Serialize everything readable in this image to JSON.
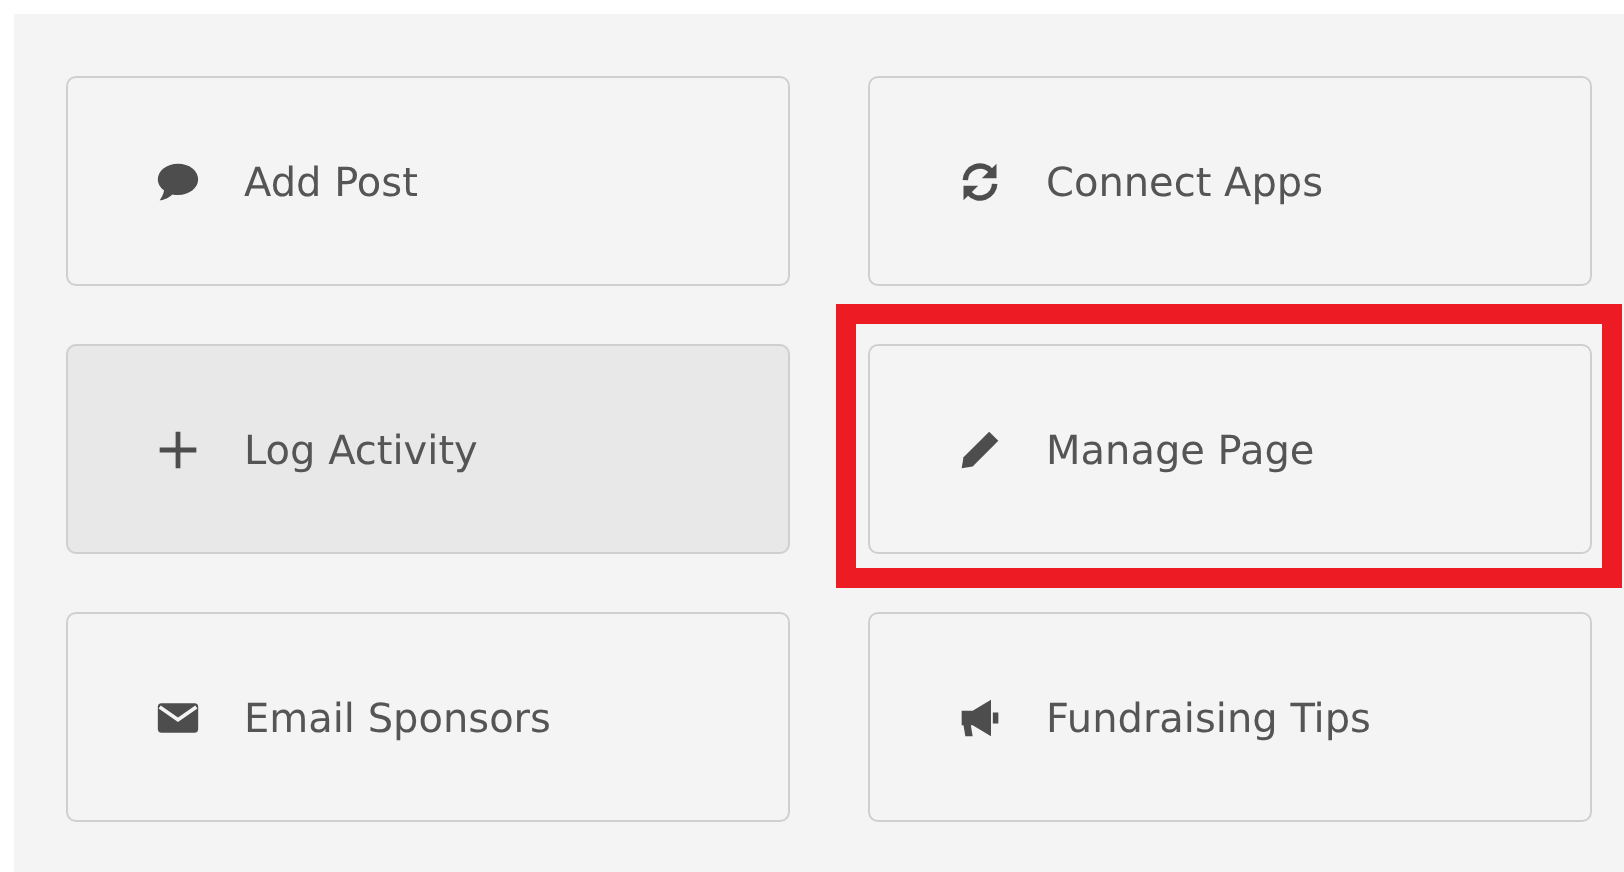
{
  "actions": [
    {
      "label": "Add Post",
      "kind": "comment",
      "hovered": false,
      "highlighted": false
    },
    {
      "label": "Connect Apps",
      "kind": "sync",
      "hovered": false,
      "highlighted": false
    },
    {
      "label": "Log Activity",
      "kind": "plus",
      "hovered": true,
      "highlighted": false
    },
    {
      "label": "Manage Page",
      "kind": "pencil",
      "hovered": false,
      "highlighted": true
    },
    {
      "label": "Email Sponsors",
      "kind": "envelope",
      "hovered": false,
      "highlighted": false
    },
    {
      "label": "Fundraising Tips",
      "kind": "bullhorn",
      "hovered": false,
      "highlighted": false
    }
  ]
}
